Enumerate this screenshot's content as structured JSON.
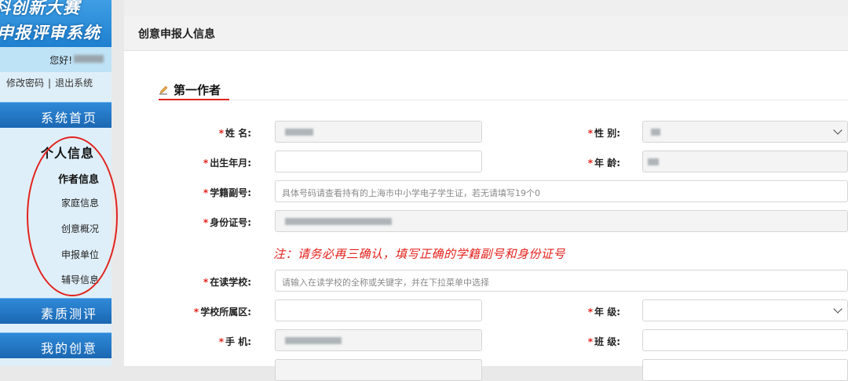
{
  "sidebar": {
    "logo_line1": "科创新大赛",
    "logo_line2": "申报评审系统",
    "greeting": "您好!",
    "change_password": "修改密码",
    "separator": "|",
    "logout": "退出系统",
    "home": "系统首页",
    "section": "个人信息",
    "sub_items": [
      "作者信息",
      "家庭信息",
      "创意概况",
      "申报单位",
      "辅导信息"
    ],
    "eval": "素质测评",
    "ideas": "我的创意"
  },
  "panel": {
    "title": "创意申报人信息",
    "section_title": "第一作者"
  },
  "form": {
    "required_mark": "*",
    "name_label": "姓 名:",
    "gender_label": "性 别:",
    "birth_label": "出生年月:",
    "age_label": "年 龄:",
    "student_no_label": "学籍副号:",
    "student_no_placeholder": "具体号码请查看持有的上海市中小学电子学生证，若无请填写19个0",
    "id_label": "身份证号:",
    "note": "注：请务必再三确认，填写正确的学籍副号和身份证号",
    "school_label": "在读学校:",
    "school_placeholder": "请输入在读学校的全称或关键字，并在下拉菜单中选择",
    "district_label": "学校所属区:",
    "grade_label": "年 级:",
    "phone_label": "手 机:",
    "class_label": "班 级:"
  },
  "colors": {
    "accent_red": "#e2221d",
    "nav_blue": "#1a67b2",
    "sidebar_bg": "#dfeff9"
  }
}
